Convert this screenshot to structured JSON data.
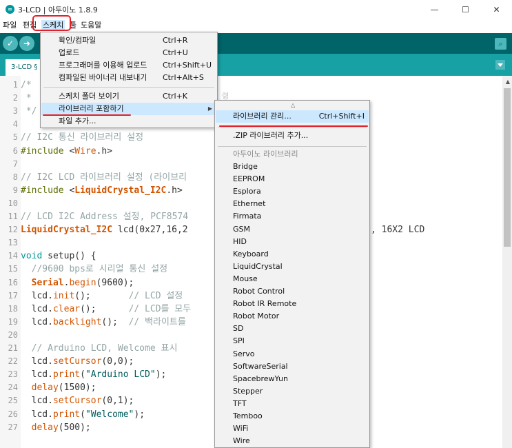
{
  "window": {
    "title": "3-LCD | 아두이노 1.8.9",
    "app_icon": "arduino-logo-icon",
    "controls": {
      "minimize": "—",
      "maximize": "☐",
      "close": "✕"
    }
  },
  "menubar": {
    "items": [
      "파일",
      "편집",
      "스케치",
      "툴",
      "도움말"
    ],
    "open_menu": "스케치"
  },
  "toolbar": {
    "verify_icon": "check-icon",
    "upload_icon": "arrow-right-icon",
    "serial_monitor_icon": "magnifier-icon",
    "glyphs": {
      "verify": "✓",
      "upload": "➜",
      "serial": "⌕"
    }
  },
  "tabs": {
    "active": "3-LCD §"
  },
  "editor": {
    "lines": [
      {
        "n": "1",
        "parts": [
          [
            "cmt",
            "/*"
          ]
        ]
      },
      {
        "n": "2",
        "parts": [
          [
            "cmt",
            " *"
          ]
        ]
      },
      {
        "n": "3",
        "parts": [
          [
            "cmt",
            " */"
          ]
        ]
      },
      {
        "n": "4",
        "parts": []
      },
      {
        "n": "5",
        "parts": [
          [
            "cmt",
            "// I2C 통신 라이브러리 설정"
          ]
        ]
      },
      {
        "n": "6",
        "parts": [
          [
            "pre",
            "#include "
          ],
          [
            "txt",
            "<"
          ],
          [
            "fn",
            "Wire"
          ],
          [
            "txt",
            ".h>"
          ]
        ]
      },
      {
        "n": "7",
        "parts": []
      },
      {
        "n": "8",
        "parts": [
          [
            "cmt",
            "// I2C LCD 라이브러리 설정 (라이브리"
          ]
        ]
      },
      {
        "n": "9",
        "parts": [
          [
            "pre",
            "#include "
          ],
          [
            "txt",
            "<"
          ],
          [
            "lib",
            "LiquidCrystal_I2C"
          ],
          [
            "txt",
            ".h>"
          ]
        ]
      },
      {
        "n": "10",
        "parts": []
      },
      {
        "n": "11",
        "parts": [
          [
            "cmt",
            "// LCD I2C Address 설정, PCF8574"
          ]
        ]
      },
      {
        "n": "12",
        "parts": [
          [
            "lib",
            "LiquidCrystal_I2C"
          ],
          [
            "txt",
            " lcd(0x27,16,2"
          ]
        ],
        "tail": ", 16X2 LCD"
      },
      {
        "n": "13",
        "parts": []
      },
      {
        "n": "14",
        "parts": [
          [
            "kw",
            "void"
          ],
          [
            "txt",
            " setup() {"
          ]
        ]
      },
      {
        "n": "15",
        "parts": [
          [
            "cmt",
            "  //9600 bps로 시리얼 통신 설정"
          ]
        ]
      },
      {
        "n": "16",
        "parts": [
          [
            "txt",
            "  "
          ],
          [
            "lib",
            "Serial"
          ],
          [
            "txt",
            "."
          ],
          [
            "fn",
            "begin"
          ],
          [
            "txt",
            "(9600);"
          ]
        ]
      },
      {
        "n": "17",
        "parts": [
          [
            "txt",
            "  lcd."
          ],
          [
            "fn",
            "init"
          ],
          [
            "txt",
            "();       "
          ],
          [
            "cmt",
            "// LCD 설정"
          ]
        ]
      },
      {
        "n": "18",
        "parts": [
          [
            "txt",
            "  lcd."
          ],
          [
            "fn",
            "clear"
          ],
          [
            "txt",
            "();      "
          ],
          [
            "cmt",
            "// LCD를 모두"
          ]
        ]
      },
      {
        "n": "19",
        "parts": [
          [
            "txt",
            "  lcd."
          ],
          [
            "fn",
            "backlight"
          ],
          [
            "txt",
            "();  "
          ],
          [
            "cmt",
            "// 백라이트를"
          ]
        ]
      },
      {
        "n": "20",
        "parts": []
      },
      {
        "n": "21",
        "parts": [
          [
            "cmt",
            "  // Arduino LCD, Welcome 표시"
          ]
        ]
      },
      {
        "n": "22",
        "parts": [
          [
            "txt",
            "  lcd."
          ],
          [
            "fn",
            "setCursor"
          ],
          [
            "txt",
            "(0,0);"
          ]
        ]
      },
      {
        "n": "23",
        "parts": [
          [
            "txt",
            "  lcd."
          ],
          [
            "fn",
            "print"
          ],
          [
            "txt",
            "("
          ],
          [
            "str",
            "\"Arduino LCD\""
          ],
          [
            "txt",
            ");"
          ]
        ]
      },
      {
        "n": "24",
        "parts": [
          [
            "txt",
            "  "
          ],
          [
            "fn",
            "delay"
          ],
          [
            "txt",
            "(1500);"
          ]
        ]
      },
      {
        "n": "25",
        "parts": [
          [
            "txt",
            "  lcd."
          ],
          [
            "fn",
            "setCursor"
          ],
          [
            "txt",
            "(0,1);"
          ]
        ]
      },
      {
        "n": "26",
        "parts": [
          [
            "txt",
            "  lcd."
          ],
          [
            "fn",
            "print"
          ],
          [
            "txt",
            "("
          ],
          [
            "str",
            "\"Welcome\""
          ],
          [
            "txt",
            ");"
          ]
        ]
      },
      {
        "n": "27",
        "parts": [
          [
            "txt",
            "  "
          ],
          [
            "fn",
            "delay"
          ],
          [
            "txt",
            "(500);"
          ]
        ]
      }
    ]
  },
  "sketch_menu": {
    "items": [
      {
        "label": "확인/컴파일",
        "shortcut": "Ctrl+R"
      },
      {
        "label": "업로드",
        "shortcut": "Ctrl+U"
      },
      {
        "label": "프로그래머를 이용해 업로드",
        "shortcut": "Ctrl+Shift+U"
      },
      {
        "label": "컴파일된 바이너리 내보내기",
        "shortcut": "Ctrl+Alt+S"
      },
      {
        "separator": true
      },
      {
        "label": "스케치 폴더 보이기",
        "shortcut": "Ctrl+K"
      },
      {
        "label": "라이브러리 포함하기",
        "shortcut": "",
        "submenu": true,
        "highlighted": true
      },
      {
        "label": "파일 추가...",
        "shortcut": ""
      }
    ],
    "peek_text": "령"
  },
  "include_library_submenu": {
    "scroll_up_glyph": "△",
    "manage": {
      "label": "라이브러리 관리...",
      "shortcut": "Ctrl+Shift+I"
    },
    "add_zip": ".ZIP 라이브러리 추가...",
    "section_header": "아두이노 라이브러리",
    "libraries": [
      "Bridge",
      "EEPROM",
      "Esplora",
      "Ethernet",
      "Firmata",
      "GSM",
      "HID",
      "Keyboard",
      "LiquidCrystal",
      "Mouse",
      "Robot Control",
      "Robot IR Remote",
      "Robot Motor",
      "SD",
      "SPI",
      "Servo",
      "SoftwareSerial",
      "SpacebrewYun",
      "Stepper",
      "TFT",
      "Temboo",
      "WiFi",
      "Wire"
    ]
  },
  "colors": {
    "toolbar": "#006468",
    "tabbar": "#17a1a5",
    "menu_highlight": "#cce8ff",
    "annotation": "#e0202a"
  }
}
